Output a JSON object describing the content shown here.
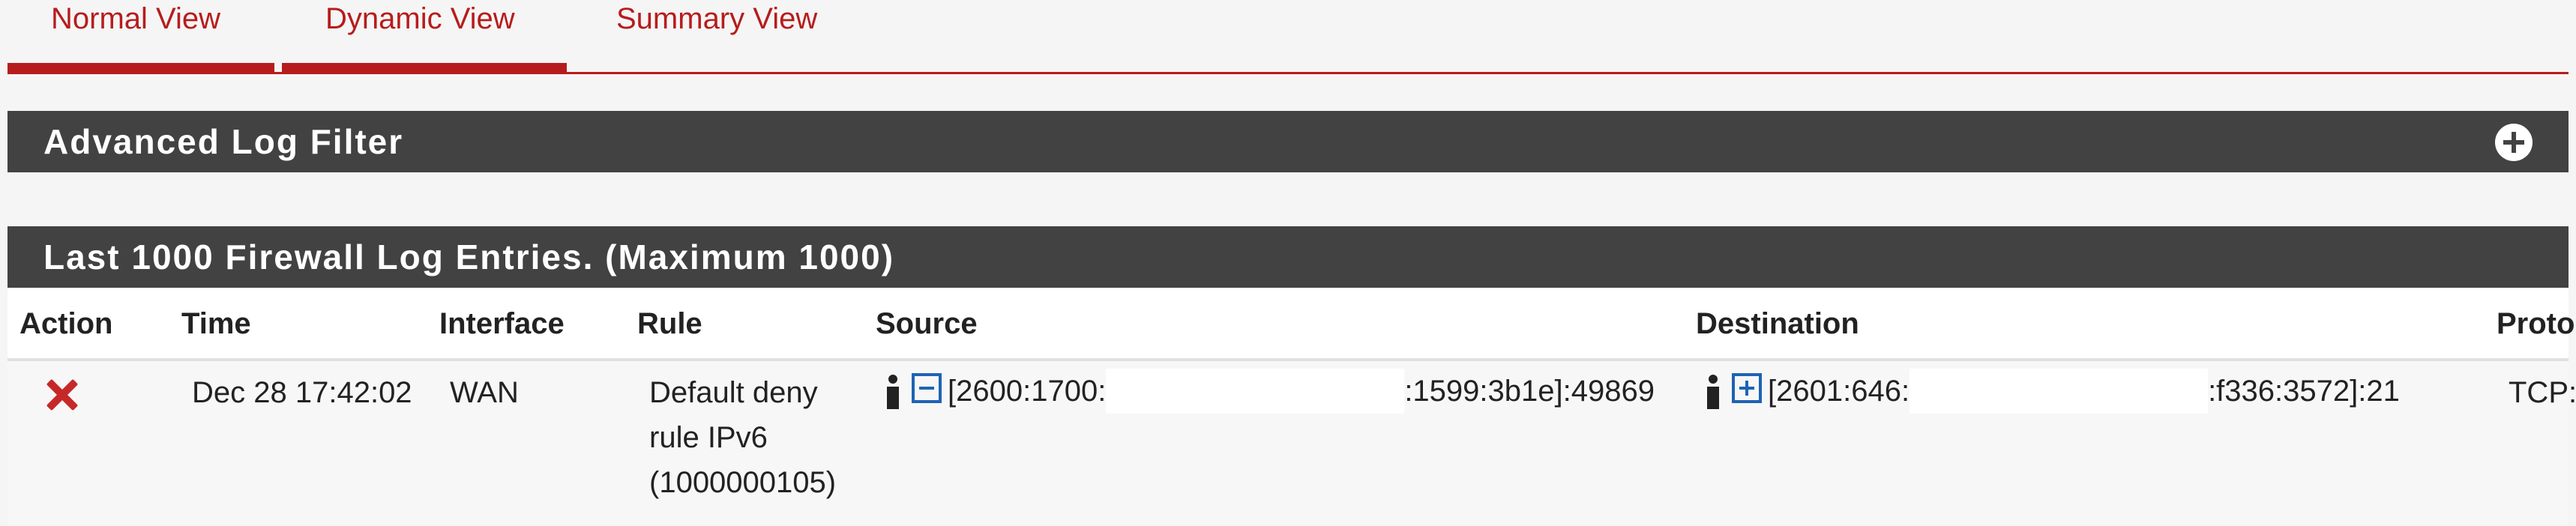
{
  "tabs": [
    {
      "label": "Normal View"
    },
    {
      "label": "Dynamic View"
    },
    {
      "label": "Summary View"
    }
  ],
  "filter_panel": {
    "title": "Advanced Log Filter",
    "toggle_icon": "plus-circle-icon"
  },
  "log_panel": {
    "title": "Last 1000 Firewall Log Entries. (Maximum 1000)"
  },
  "table": {
    "headers": [
      "Action",
      "Time",
      "Interface",
      "Rule",
      "Source",
      "Destination",
      "Proto"
    ],
    "rows": [
      {
        "action_icon": "block-x-icon",
        "time": "Dec 28 17:42:02",
        "interface": "WAN",
        "rule_lines": [
          "Default deny",
          "rule IPv6",
          "(1000000105)"
        ],
        "source_prefix": "[2600:1700:",
        "source_suffix": ":1599:3b1e]:49869",
        "destination_prefix": "[2601:646:",
        "destination_suffix": ":f336:3572]:21",
        "proto": "TCP:"
      }
    ]
  },
  "colors": {
    "accent": "#b71c1c",
    "panel_header": "#424242",
    "link_icon": "#1e63b5",
    "block": "#c62828"
  }
}
